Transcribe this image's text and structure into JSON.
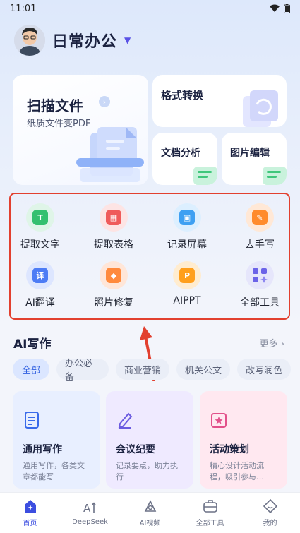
{
  "status_bar": {
    "time": "11:01"
  },
  "profile": {
    "name": "日常办公"
  },
  "feature_cards": {
    "scan": {
      "title": "扫描文件",
      "subtitle": "纸质文件变PDF"
    },
    "format": {
      "title": "格式转换"
    },
    "doc_analysis": {
      "title": "文档分析"
    },
    "image_edit": {
      "title": "图片编辑"
    }
  },
  "tools": [
    {
      "label": "提取文字",
      "icon": "text-extract-icon"
    },
    {
      "label": "提取表格",
      "icon": "table-extract-icon"
    },
    {
      "label": "记录屏幕",
      "icon": "screen-record-icon"
    },
    {
      "label": "去手写",
      "icon": "remove-handwriting-icon"
    },
    {
      "label": "AI翻译",
      "icon": "translate-icon"
    },
    {
      "label": "照片修复",
      "icon": "photo-repair-icon"
    },
    {
      "label": "AIPPT",
      "icon": "ppt-icon"
    },
    {
      "label": "全部工具",
      "icon": "all-tools-icon"
    }
  ],
  "ai_writing": {
    "title": "AI写作",
    "more": "更多 ›",
    "chips": [
      "全部",
      "办公必备",
      "商业营销",
      "机关公文",
      "改写润色"
    ],
    "cards": [
      {
        "title": "通用写作",
        "desc": "通用写作，各类文章都能写"
      },
      {
        "title": "会议纪要",
        "desc": "记录要点，助力执行"
      },
      {
        "title": "活动策划",
        "desc": "精心设计活动流程，吸引参与…"
      }
    ]
  },
  "bottom_nav": [
    {
      "label": "首页",
      "active": true
    },
    {
      "label": "DeepSeek"
    },
    {
      "label": "AI视频"
    },
    {
      "label": "全部工具"
    },
    {
      "label": "我的"
    }
  ],
  "colors": {
    "accent": "#3c4ee0",
    "highlight_frame": "#e2402f"
  }
}
